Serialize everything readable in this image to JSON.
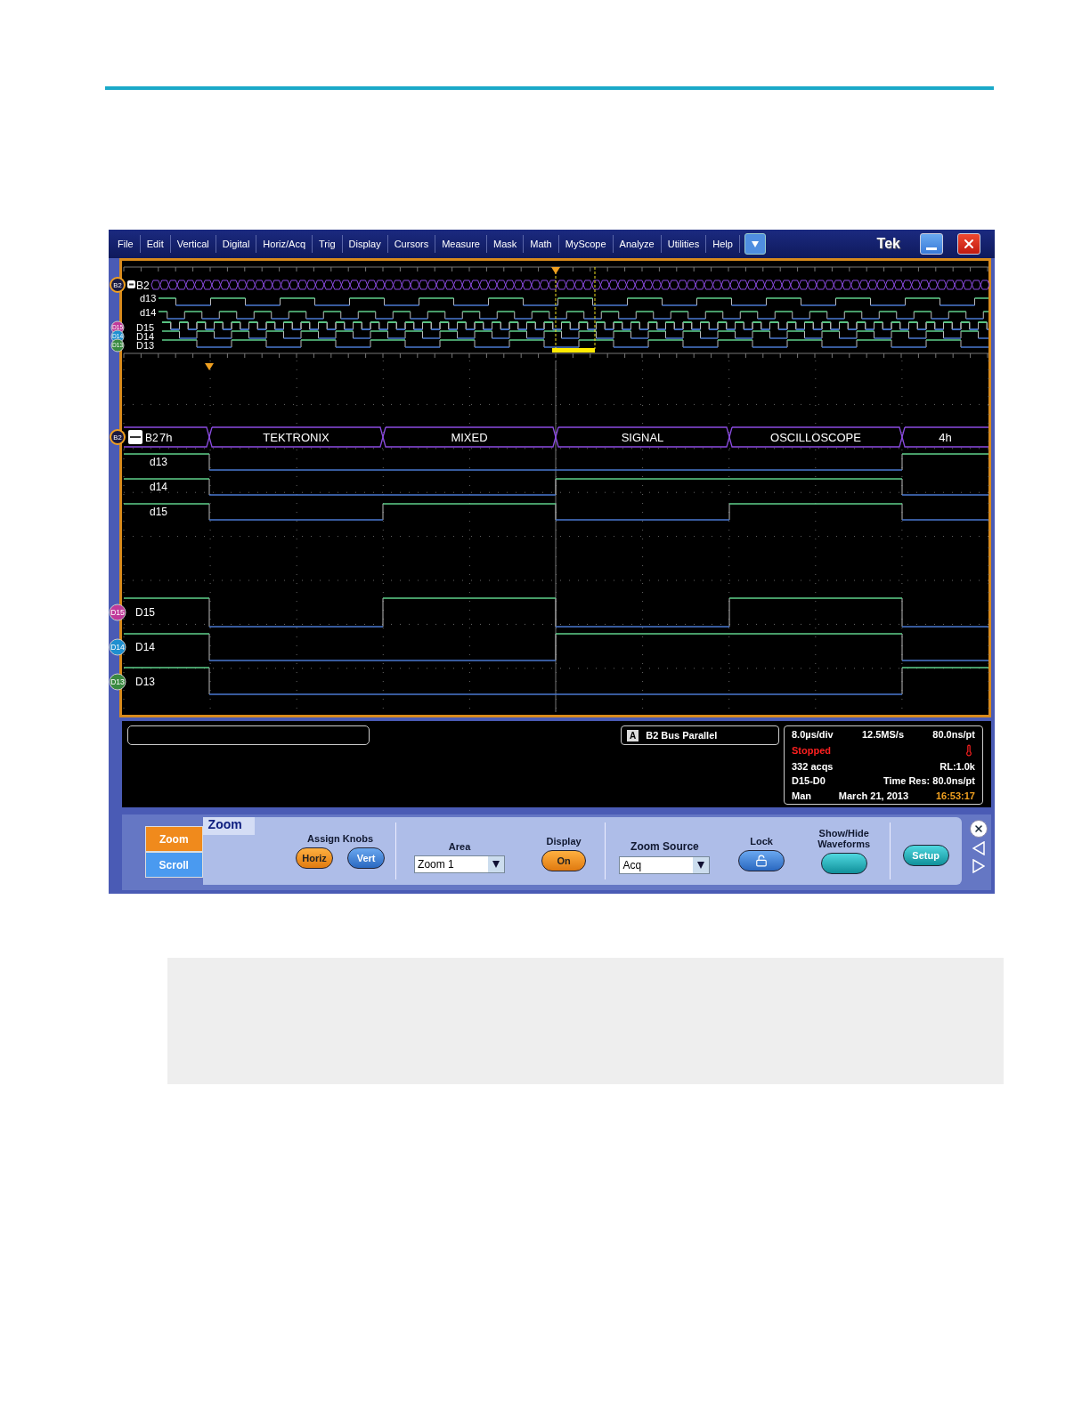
{
  "menu_bar": {
    "items": [
      "File",
      "Edit",
      "Vertical",
      "Digital",
      "Horiz/Acq",
      "Trig",
      "Display",
      "Cursors",
      "Measure",
      "Mask",
      "Math",
      "MyScope",
      "Analyze",
      "Utilities",
      "Help"
    ],
    "brand": "Tek"
  },
  "overview": {
    "bus": {
      "badge": "B2",
      "label": "B2"
    },
    "bus_channels": [
      "d13",
      "d14"
    ],
    "channels": [
      {
        "badge": "D15",
        "label": "D15",
        "color": "#c0399a"
      },
      {
        "badge": "D14",
        "label": "D14",
        "color": "#1e8fd0"
      },
      {
        "badge": "D13",
        "label": "D13",
        "color": "#3a8a40"
      }
    ]
  },
  "zoom_view": {
    "bus": {
      "badge": "B2",
      "label": "B2",
      "segments": [
        "7h",
        "TEKTRONIX",
        "MIXED",
        "SIGNAL",
        "OSCILLOSCOPE",
        "4h"
      ]
    },
    "bus_channels": [
      "d13",
      "d14",
      "d15"
    ],
    "channels": [
      {
        "badge": "D15",
        "label": "D15",
        "color": "#c0399a"
      },
      {
        "badge": "D14",
        "label": "D14",
        "color": "#1e8fd0"
      },
      {
        "badge": "D13",
        "label": "D13",
        "color": "#3a8a40"
      }
    ]
  },
  "trigger": {
    "source": "A",
    "label": "B2 Bus Parallel"
  },
  "readout": [
    [
      {
        "text": "8.0µs/div",
        "kind": "value"
      },
      {
        "text": "12.5MS/s",
        "kind": "value"
      },
      {
        "text": "80.0ns/pt",
        "kind": "value"
      }
    ],
    [
      {
        "text": "Stopped",
        "kind": "status"
      }
    ],
    [
      {
        "text": "332 acqs",
        "kind": "value"
      },
      {
        "text": "RL:1.0k",
        "kind": "value"
      }
    ],
    [
      {
        "text": "D15-D0",
        "kind": "value"
      },
      {
        "text": "Time Res: 80.0ns/pt",
        "kind": "value"
      }
    ],
    [
      {
        "text": "Man",
        "kind": "value"
      },
      {
        "text": "March 21, 2013",
        "kind": "value"
      },
      {
        "text": "16:53:17",
        "kind": "clock"
      }
    ]
  ],
  "control_panel": {
    "side_tabs": [
      {
        "label": "Zoom",
        "selected": true
      },
      {
        "label": "Scroll",
        "selected": false
      }
    ],
    "title": "Zoom",
    "assign_knobs": {
      "label": "Assign Knobs",
      "knobs": [
        {
          "label": "Horiz",
          "selected": true
        },
        {
          "label": "Vert",
          "selected": false
        }
      ]
    },
    "area": {
      "label": "Area",
      "value": "Zoom 1"
    },
    "display": {
      "label": "Display",
      "button": "On",
      "on": true
    },
    "zoom_source": {
      "label": "Zoom Source",
      "value": "Acq"
    },
    "lock": {
      "label": "Lock"
    },
    "show_hide": {
      "label": "Show/Hide Waveforms"
    },
    "setup": "Setup"
  }
}
